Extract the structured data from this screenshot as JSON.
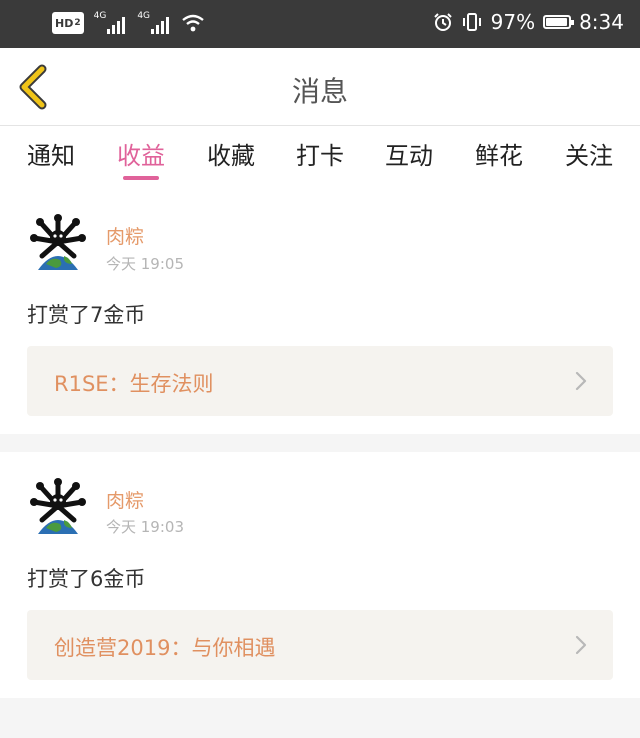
{
  "status_bar": {
    "hd": "HD",
    "hd_sub": "2",
    "net1": "4G",
    "net2": "4G",
    "battery_percent": "97%",
    "battery_level": 0.97,
    "time": "8:34",
    "icons": [
      "signal-icon",
      "wifi-icon",
      "alarm-icon",
      "vibrate-icon",
      "battery-icon"
    ]
  },
  "header": {
    "title": "消息",
    "back_icon": "chevron-left-icon",
    "accent_color": "#f0c419"
  },
  "tabs": [
    {
      "label": "通知",
      "active": false
    },
    {
      "label": "收益",
      "active": true
    },
    {
      "label": "收藏",
      "active": false
    },
    {
      "label": "打卡",
      "active": false
    },
    {
      "label": "互动",
      "active": false
    },
    {
      "label": "鲜花",
      "active": false
    },
    {
      "label": "关注",
      "active": false
    }
  ],
  "colors": {
    "active_tab": "#e0629a",
    "username": "#e59a6a",
    "link": "#e09060"
  },
  "items": [
    {
      "user": "肉粽",
      "time": "今天 19:05",
      "message": "打赏了7金币",
      "link": "R1SE：生存法则"
    },
    {
      "user": "肉粽",
      "time": "今天 19:03",
      "message": "打赏了6金币",
      "link": "创造营2019：与你相遇"
    }
  ]
}
